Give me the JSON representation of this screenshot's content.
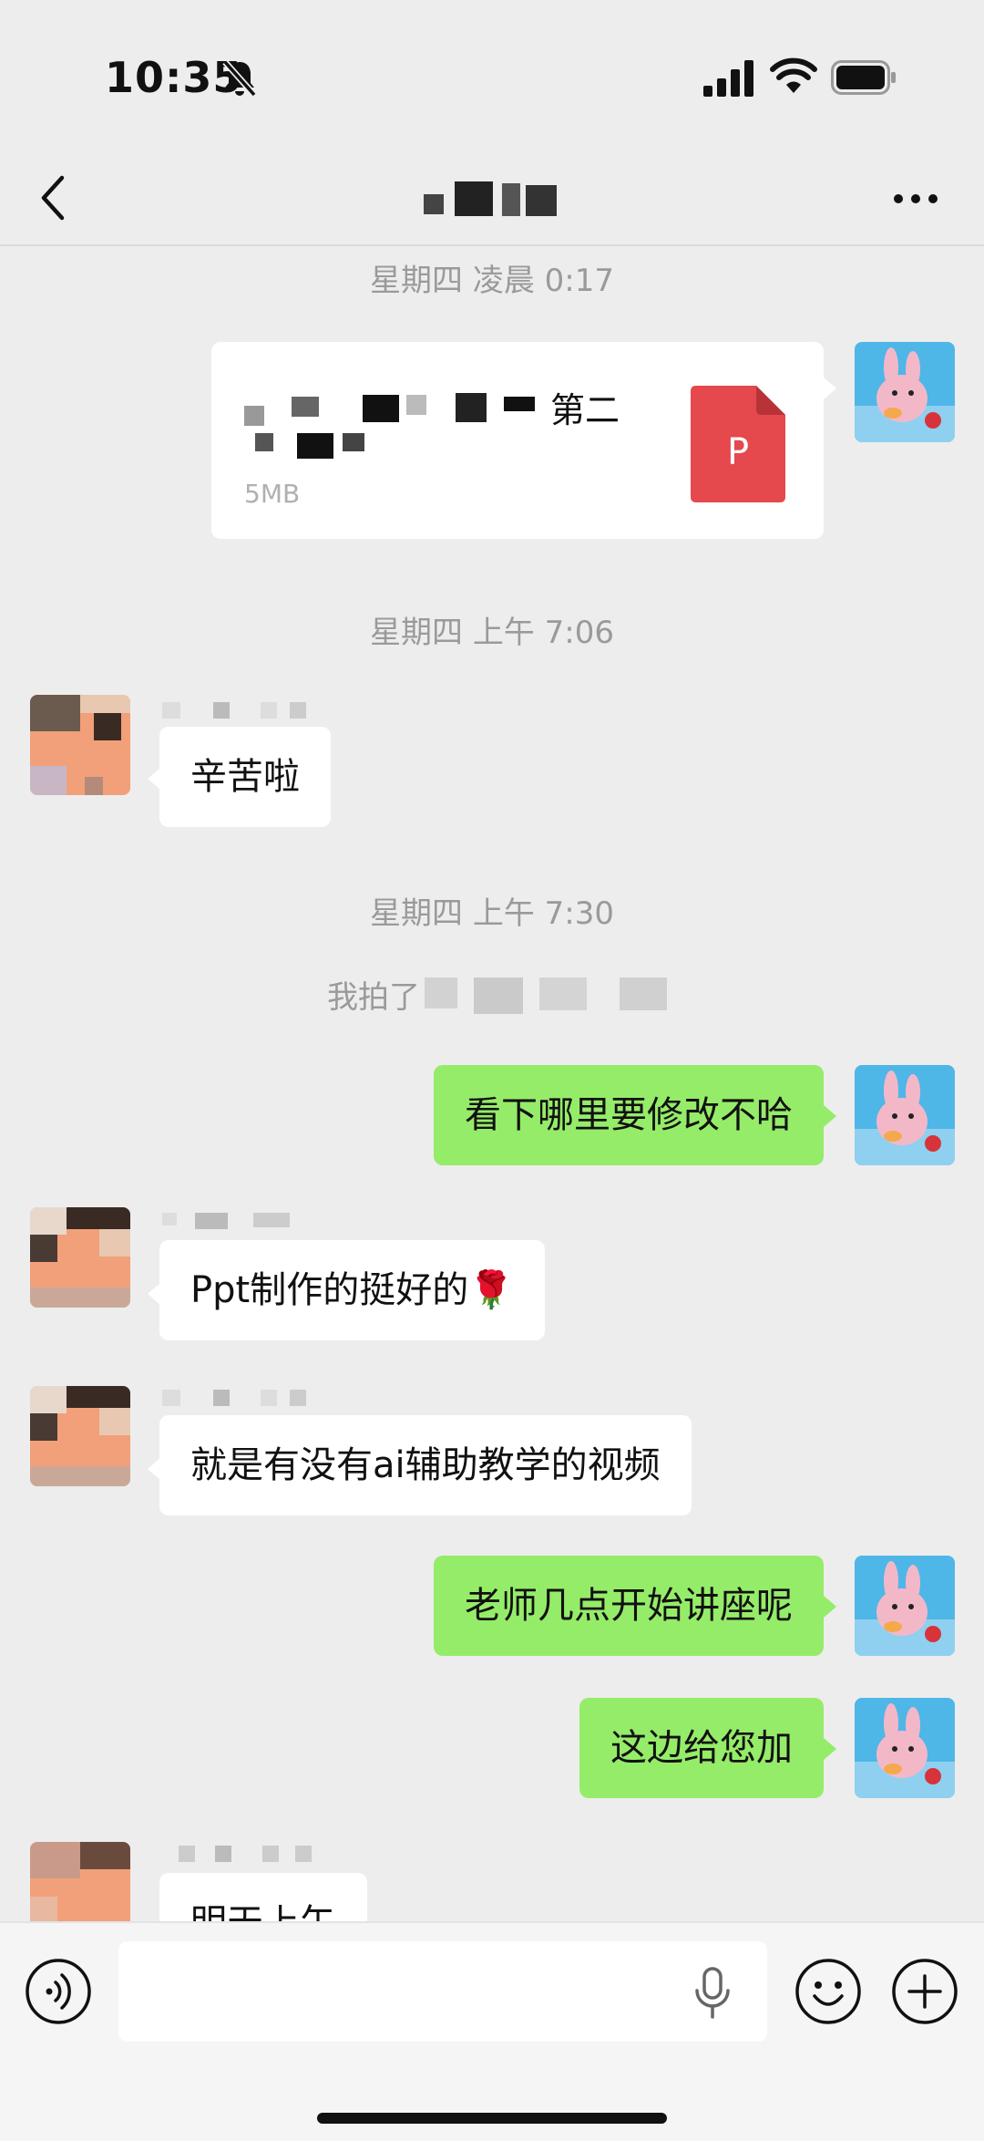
{
  "status_bar": {
    "time": "10:35",
    "icons": [
      "mute-icon",
      "signal-icon",
      "wifi-icon",
      "battery-icon"
    ]
  },
  "nav": {
    "back_icon": "chevron-left-icon",
    "title": "",
    "more_icon": "more-dots-icon"
  },
  "chat": {
    "timestamps": [
      "星期四 凌晨 0:17",
      "星期四 上午 7:06",
      "星期四 上午 7:30"
    ],
    "file_message": {
      "name": "第二",
      "size": "5MB",
      "icon": "ppt-file-icon",
      "icon_letter": "P",
      "icon_color": "#e5484d"
    },
    "system_note": "我拍了",
    "messages": [
      {
        "dir": "in",
        "text": "辛苦啦"
      },
      {
        "dir": "out",
        "text": "看下哪里要修改不哈"
      },
      {
        "dir": "in",
        "text": "Ppt制作的挺好的🌹"
      },
      {
        "dir": "in",
        "text": "就是有没有ai辅助教学的视频"
      },
      {
        "dir": "out",
        "text": "老师几点开始讲座呢"
      },
      {
        "dir": "out",
        "text": "这边给您加"
      },
      {
        "dir": "in",
        "text": "明天上午"
      }
    ]
  },
  "input_bar": {
    "placeholder": "",
    "icons": [
      "voice-icon",
      "mic-icon",
      "emoji-icon",
      "plus-icon"
    ]
  },
  "colors": {
    "background": "#ededed",
    "outgoing_bubble": "#95ec69",
    "incoming_bubble": "#ffffff",
    "timestamp_text": "#9a9a9a"
  }
}
